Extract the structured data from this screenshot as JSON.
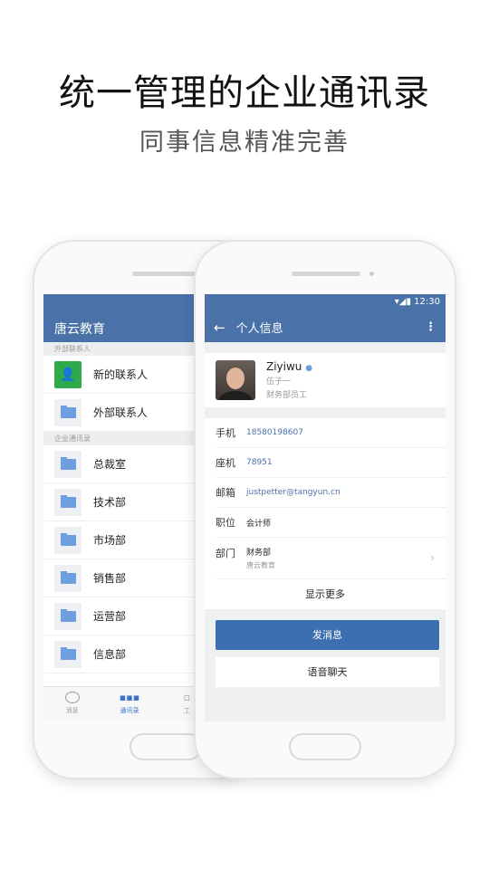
{
  "headline": "统一管理的企业通讯录",
  "subheadline": "同事信息精准完善",
  "back_screen": {
    "title": "唐云教育",
    "section_external": "外部联系人",
    "external_items": [
      {
        "label": "新的联系人",
        "icon": "add-contact-icon"
      },
      {
        "label": "外部联系人",
        "icon": "folder-icon"
      }
    ],
    "section_company": "企业通讯录",
    "departments": [
      "总裁室",
      "技术部",
      "市场部",
      "销售部",
      "运营部",
      "信息部"
    ],
    "nav": [
      {
        "label": "消息",
        "icon": "chat-bubble-icon"
      },
      {
        "label": "通讯录",
        "icon": "org-chart-icon",
        "active": true
      },
      {
        "label": "工",
        "icon": "grid-icon"
      }
    ]
  },
  "front_screen": {
    "status_time": "12:30",
    "title": "个人信息",
    "profile": {
      "name": "Ziyiwu",
      "alias": "伍子一",
      "role": "财务部员工"
    },
    "fields": [
      {
        "label": "手机",
        "value": "18580198607"
      },
      {
        "label": "座机",
        "value": "78951"
      },
      {
        "label": "邮箱",
        "value": "justpetter@tangyun.cn"
      },
      {
        "label": "职位",
        "value": "会计师"
      },
      {
        "label": "部门",
        "value": "财务部",
        "sub": "唐云教育"
      }
    ],
    "show_more": "显示更多",
    "send_message": "发消息",
    "voice_chat": "语音聊天"
  },
  "colors": {
    "brand": "#4a72a8",
    "button": "#3b6fb0",
    "green": "#2eaa4a"
  }
}
